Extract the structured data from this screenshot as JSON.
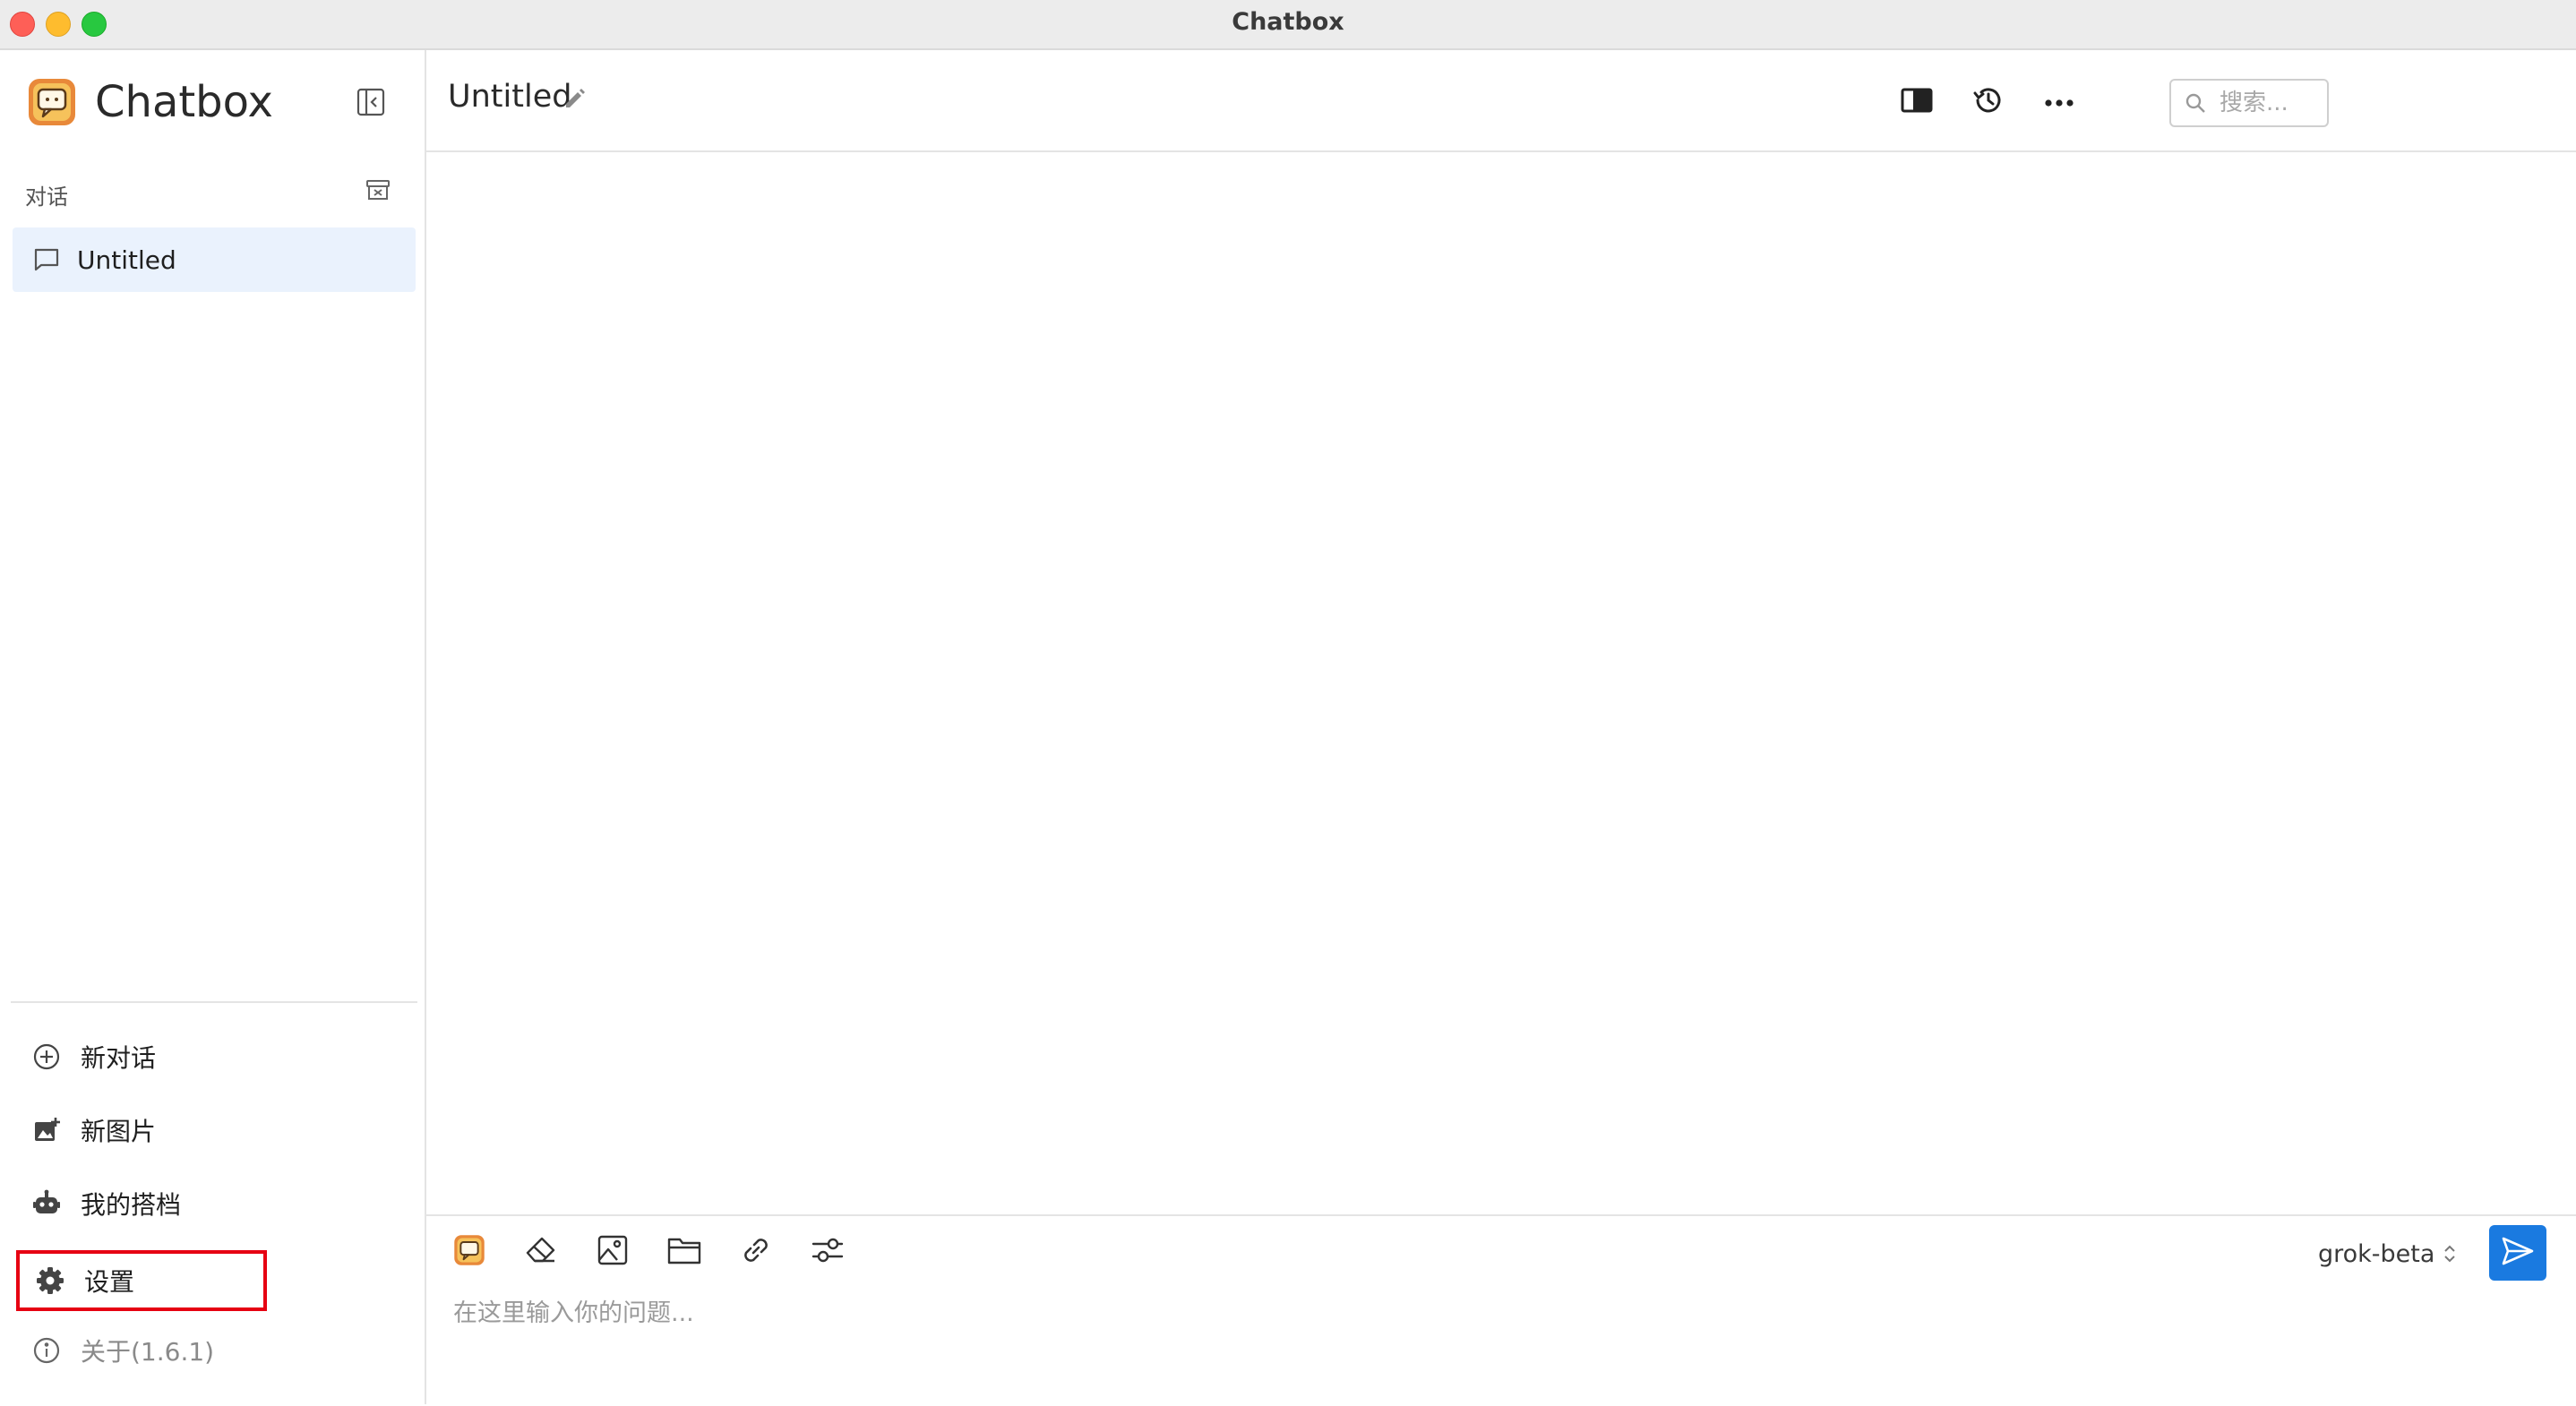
{
  "window": {
    "title": "Chatbox"
  },
  "sidebar": {
    "app_name": "Chatbox",
    "section_label": "对话",
    "conversations": [
      {
        "label": "Untitled",
        "selected": true
      }
    ],
    "nav": {
      "new_chat": "新对话",
      "new_image": "新图片",
      "my_partners": "我的搭档",
      "settings": "设置",
      "about": "关于(1.6.1)"
    }
  },
  "header": {
    "session_title": "Untitled",
    "search_placeholder": "搜索..."
  },
  "composer": {
    "model": "grok-beta",
    "input_placeholder": "在这里输入你的问题..."
  },
  "icons": {
    "app_logo": "chatbox-logo-icon",
    "sidebar_toggle": "sidebar-collapse-icon",
    "archive": "archive-icon",
    "chat": "chat-bubble-icon",
    "plus": "plus-circle-icon",
    "image_add": "image-add-icon",
    "robot": "robot-icon",
    "settings": "gear-icon",
    "info": "info-icon",
    "edit": "pencil-icon",
    "search": "search-icon",
    "layout": "split-view-icon",
    "history": "history-icon",
    "more": "more-horizontal-icon",
    "eraser": "eraser-icon",
    "image": "image-icon",
    "folder": "folder-icon",
    "link": "link-icon",
    "settings_sliders": "sliders-icon",
    "chevron": "chevron-updown-icon",
    "send": "send-icon"
  },
  "colors": {
    "selected_bg": "#eaf2fd",
    "accent": "#1a7ae0",
    "highlight_border": "#e60012"
  }
}
